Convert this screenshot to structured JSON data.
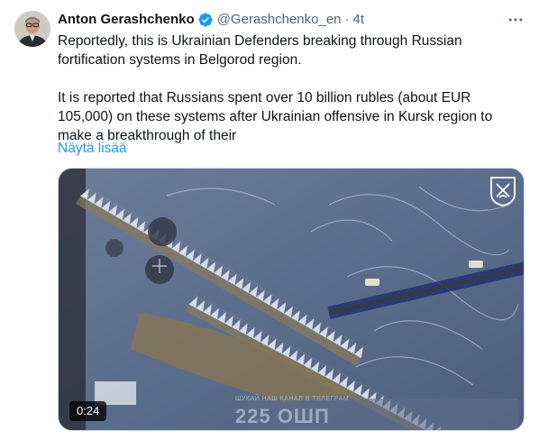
{
  "author": {
    "name": "Anton Gerashchenko",
    "handle": "@Gerashchenko_en",
    "separator": "·",
    "time": "4t",
    "verified": true
  },
  "tweet": {
    "text": "Reportedly, this is Ukrainian Defenders breaking through Russian fortification systems in Belgorod region.\n\nIt is reported that Russians spent over 10 billion rubles (about EUR 105,000) on these systems after Ukrainian offensive in Kursk region to make a breakthrough of their",
    "show_more": "Näytä lisää"
  },
  "media": {
    "duration": "0:24",
    "watermark_main": "225 ОШП",
    "watermark_sub": "ШУКАЙ НАШ КАНАЛ В ТЕЛЕГРАМ"
  },
  "icons": {
    "verified": "verified-badge-icon",
    "more": "more-options-icon",
    "corner_logo": "unit-shield-logo"
  },
  "colors": {
    "link": "#1d9bf0",
    "secondary": "#536471",
    "verified": "#1d9bf0"
  }
}
